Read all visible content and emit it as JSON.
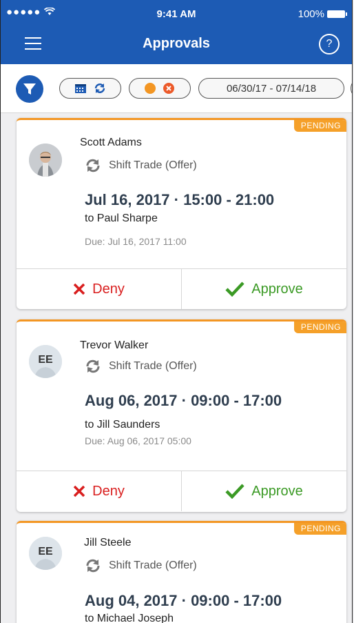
{
  "status_bar": {
    "signal": "●●●●● ",
    "time": "9:41 AM",
    "battery": "100%"
  },
  "nav": {
    "title": "Approvals",
    "help": "?"
  },
  "filters": {
    "date_range": "06/30/17 - 07/14/18"
  },
  "colors": {
    "brand": "#1d5bb4",
    "pending": "#f5a029",
    "deny": "#d91e1e",
    "approve": "#3b9a25",
    "filter_dot": "#f39623"
  },
  "cards": [
    {
      "badge": "PENDING",
      "name": "Scott Adams",
      "avatar_initials": "",
      "type": "Shift Trade (Offer)",
      "shift": "Jul 16, 2017 · 15:00 - 21:00",
      "to": "to  Paul Sharpe",
      "due": "Due: Jul 16, 2017 11:00",
      "deny_label": "Deny",
      "approve_label": "Approve"
    },
    {
      "badge": "PENDING",
      "name": "Trevor Walker",
      "avatar_initials": "EE",
      "type": "Shift Trade (Offer)",
      "shift": "Aug 06, 2017 · 09:00 - 17:00",
      "to": "to Jill Saunders",
      "due": "Due: Aug 06, 2017 05:00",
      "deny_label": "Deny",
      "approve_label": "Approve"
    },
    {
      "badge": "PENDING",
      "name": "Jill Steele",
      "avatar_initials": "EE",
      "type": "Shift Trade (Offer)",
      "shift": "Aug 04, 2017 · 09:00 - 17:00",
      "to": "to Michael Joseph"
    }
  ]
}
